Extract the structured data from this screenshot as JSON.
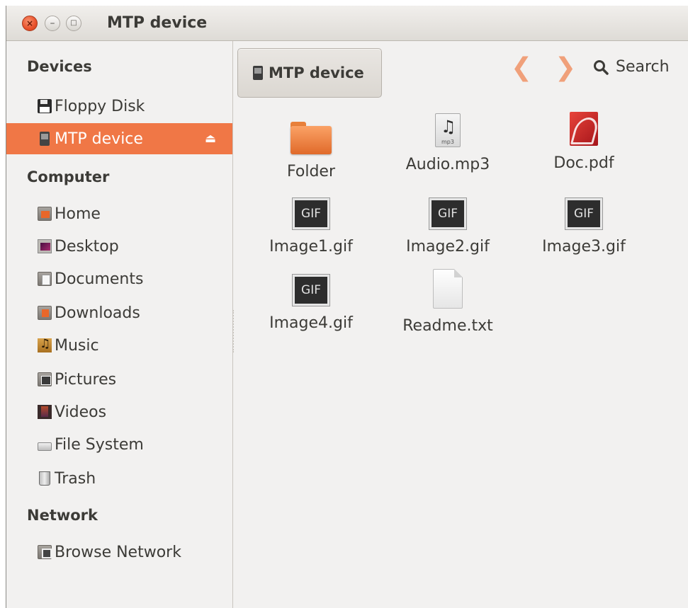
{
  "window": {
    "title": "MTP device"
  },
  "sidebar": {
    "sections": {
      "devices": "Devices",
      "computer": "Computer",
      "network": "Network"
    },
    "devices": [
      {
        "label": "Floppy Disk",
        "icon": "floppy-icon"
      },
      {
        "label": "MTP device",
        "icon": "mtp-device-icon",
        "active": true,
        "eject": "⏏"
      }
    ],
    "computer": [
      {
        "label": "Home",
        "icon": "home-folder-icon"
      },
      {
        "label": "Desktop",
        "icon": "desktop-folder-icon"
      },
      {
        "label": "Documents",
        "icon": "documents-folder-icon"
      },
      {
        "label": "Downloads",
        "icon": "downloads-folder-icon"
      },
      {
        "label": "Music",
        "icon": "music-folder-icon"
      },
      {
        "label": "Pictures",
        "icon": "pictures-folder-icon"
      },
      {
        "label": "Videos",
        "icon": "videos-folder-icon"
      },
      {
        "label": "File System",
        "icon": "drive-icon"
      },
      {
        "label": "Trash",
        "icon": "trash-icon"
      }
    ],
    "network": [
      {
        "label": "Browse Network",
        "icon": "network-icon"
      }
    ]
  },
  "toolbar": {
    "path_label": "MTP device",
    "back_glyph": "❮",
    "forward_glyph": "❯",
    "search_label": "Search"
  },
  "files": [
    {
      "name": "Folder",
      "icon": "folder-icon"
    },
    {
      "name": "Audio.mp3",
      "icon": "audio-file-icon",
      "badge": "mp3"
    },
    {
      "name": "Doc.pdf",
      "icon": "pdf-file-icon"
    },
    {
      "name": "Image1.gif",
      "icon": "gif-file-icon",
      "badge": "GIF"
    },
    {
      "name": "Image2.gif",
      "icon": "gif-file-icon",
      "badge": "GIF"
    },
    {
      "name": "Image3.gif",
      "icon": "gif-file-icon",
      "badge": "GIF"
    },
    {
      "name": "Image4.gif",
      "icon": "gif-file-icon",
      "badge": "GIF"
    },
    {
      "name": "Readme.txt",
      "icon": "text-file-icon"
    }
  ],
  "colors": {
    "accent": "#f07746",
    "nav_arrow": "#f0a07a",
    "background": "#f2f1f0"
  }
}
